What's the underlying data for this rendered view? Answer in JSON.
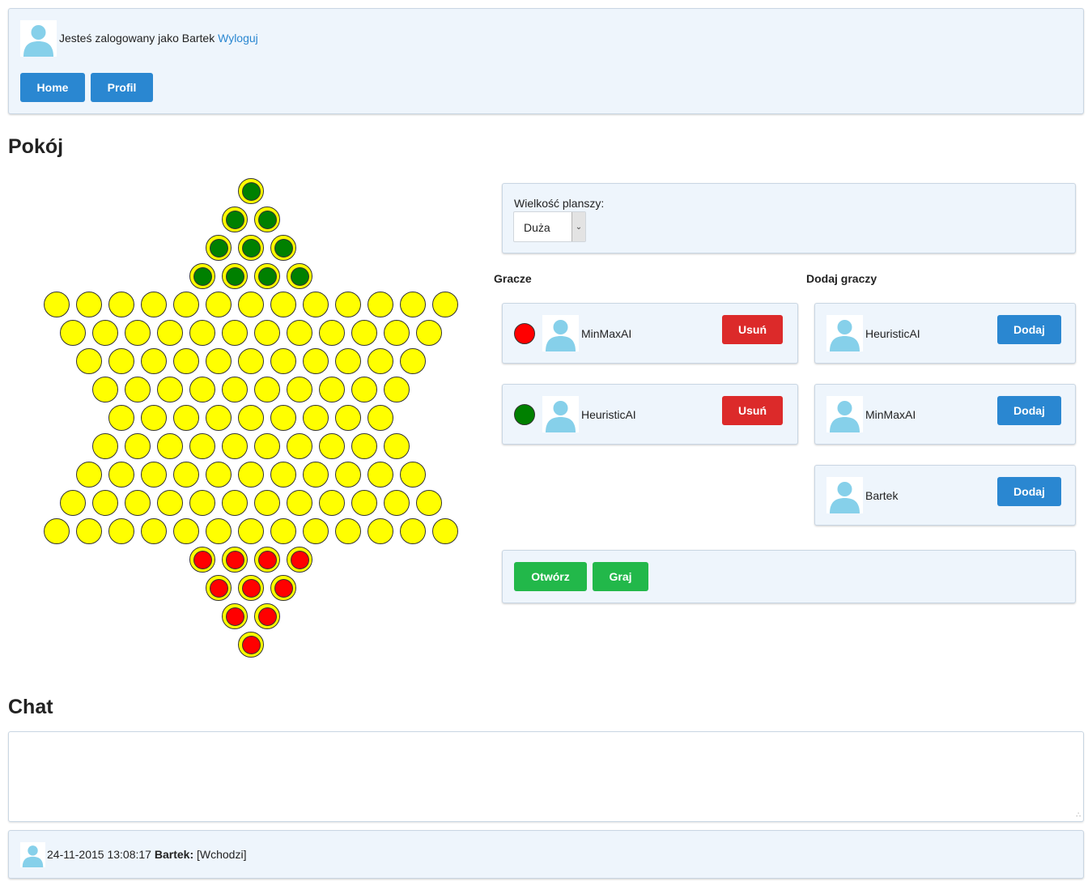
{
  "header": {
    "logged_in_text": "Jesteś zalogowany jako Bartek",
    "logout_label": "Wyloguj",
    "nav": [
      {
        "label": "Home"
      },
      {
        "label": "Profil"
      }
    ]
  },
  "room": {
    "title": "Pokój",
    "board_size_label": "Wielkość planszy:",
    "board_size_value": "Duża",
    "players_heading": "Gracze",
    "add_players_heading": "Dodaj graczy",
    "players": [
      {
        "name": "MinMaxAI",
        "color": "#ff0000",
        "action": "Usuń"
      },
      {
        "name": "HeuristicAI",
        "color": "#008000",
        "action": "Usuń"
      }
    ],
    "available_players": [
      {
        "name": "HeuristicAI",
        "action": "Dodaj"
      },
      {
        "name": "MinMaxAI",
        "action": "Dodaj"
      },
      {
        "name": "Bartek",
        "action": "Dodaj"
      }
    ],
    "open_label": "Otwórz",
    "play_label": "Graj"
  },
  "board": {
    "type": "chinese-checkers-star",
    "colors": {
      "empty": "#ffff00",
      "player1": "#ff0000",
      "player2": "#008000"
    },
    "rows": [
      {
        "holes": 1,
        "piece": "player2"
      },
      {
        "holes": 2,
        "piece": "player2"
      },
      {
        "holes": 3,
        "piece": "player2"
      },
      {
        "holes": 4,
        "piece": "player2"
      },
      {
        "holes": 13,
        "piece": "empty"
      },
      {
        "holes": 12,
        "piece": "empty"
      },
      {
        "holes": 11,
        "piece": "empty"
      },
      {
        "holes": 10,
        "piece": "empty"
      },
      {
        "holes": 9,
        "piece": "empty"
      },
      {
        "holes": 10,
        "piece": "empty"
      },
      {
        "holes": 11,
        "piece": "empty"
      },
      {
        "holes": 12,
        "piece": "empty"
      },
      {
        "holes": 13,
        "piece": "empty"
      },
      {
        "holes": 4,
        "piece": "player1"
      },
      {
        "holes": 3,
        "piece": "player1"
      },
      {
        "holes": 2,
        "piece": "player1"
      },
      {
        "holes": 1,
        "piece": "player1"
      }
    ]
  },
  "chat": {
    "title": "Chat",
    "input_value": "",
    "messages": [
      {
        "timestamp": "24-11-2015 13:08:17",
        "author": "Bartek:",
        "text": "[Wchodzi]"
      }
    ]
  }
}
